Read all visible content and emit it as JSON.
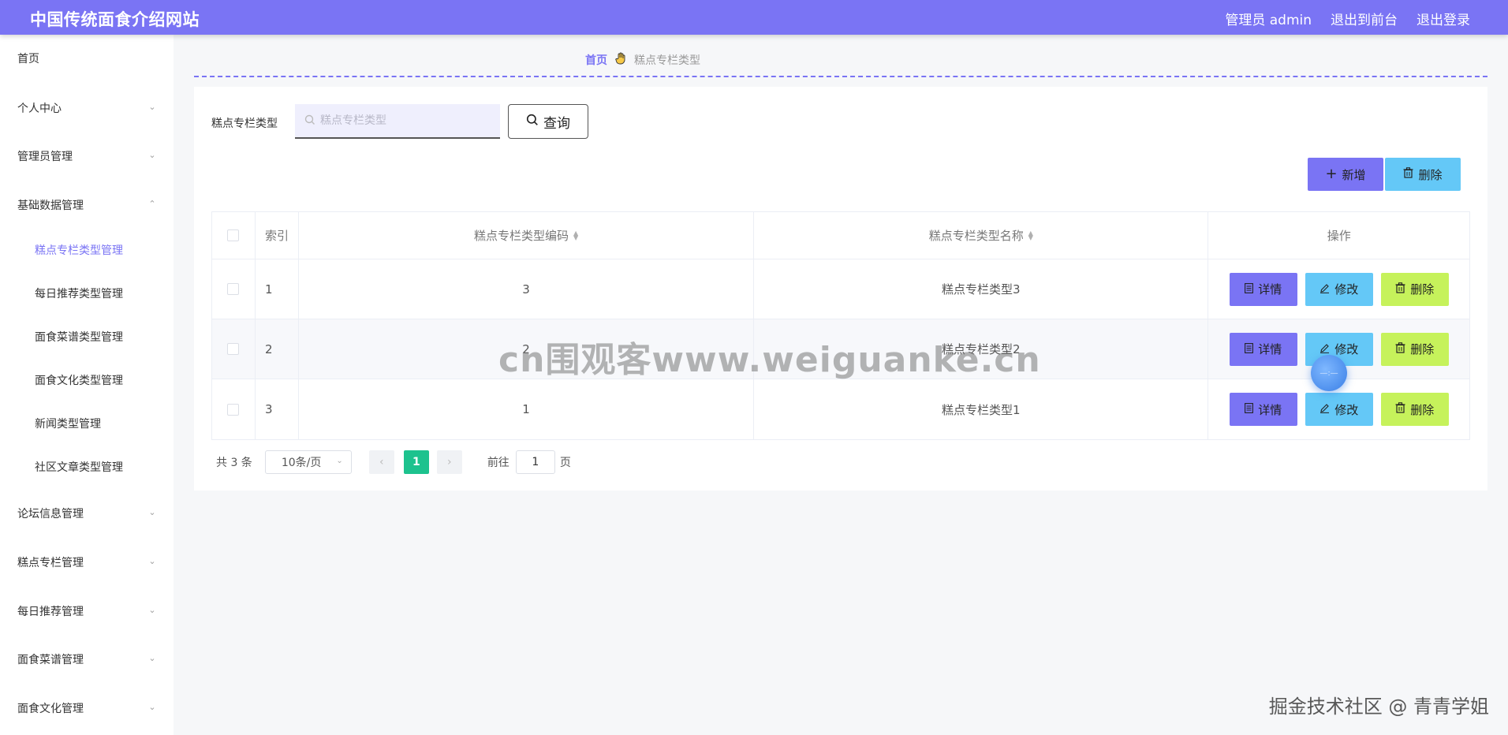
{
  "header": {
    "site_title": "中国传统面食介绍网站",
    "user_label": "管理员 admin",
    "to_frontend": "退出到前台",
    "logout": "退出登录"
  },
  "sidebar": {
    "items": [
      {
        "label": "首页"
      },
      {
        "label": "个人中心"
      },
      {
        "label": "管理员管理"
      },
      {
        "label": "基础数据管理"
      },
      {
        "label": "糕点专栏类型管理"
      },
      {
        "label": "每日推荐类型管理"
      },
      {
        "label": "面食菜谱类型管理"
      },
      {
        "label": "面食文化类型管理"
      },
      {
        "label": "新闻类型管理"
      },
      {
        "label": "社区文章类型管理"
      },
      {
        "label": "论坛信息管理"
      },
      {
        "label": "糕点专栏管理"
      },
      {
        "label": "每日推荐管理"
      },
      {
        "label": "面食菜谱管理"
      },
      {
        "label": "面食文化管理"
      }
    ]
  },
  "breadcrumb": {
    "home": "首页",
    "current": "糕点专栏类型"
  },
  "search": {
    "label": "糕点专栏类型",
    "placeholder": "糕点专栏类型",
    "query_button": "查询"
  },
  "toolbar": {
    "add_label": "新增",
    "delete_label": "删除"
  },
  "table": {
    "columns": {
      "index": "索引",
      "code": "糕点专栏类型编码",
      "name": "糕点专栏类型名称",
      "ops": "操作"
    },
    "rows": [
      {
        "index": "1",
        "code": "3",
        "name": "糕点专栏类型3"
      },
      {
        "index": "2",
        "code": "2",
        "name": "糕点专栏类型2"
      },
      {
        "index": "3",
        "code": "1",
        "name": "糕点专栏类型1"
      }
    ],
    "op_labels": {
      "detail": "详情",
      "edit": "修改",
      "delete": "删除"
    }
  },
  "pagination": {
    "total": "共 3 条",
    "page_size": "10条/页",
    "current_page": "1",
    "jump_label": "前往",
    "jump_value": "1",
    "jump_unit": "页"
  },
  "overlays": {
    "watermark_center": "cn围观客www.weiguanke.cn",
    "watermark_corner": "掘金技术社区 @ 青青学姐"
  },
  "colors": {
    "primary": "#7a74f4",
    "info": "#64c8f7",
    "warning_lime": "#c6f25b",
    "page_active": "#1dc28e"
  }
}
